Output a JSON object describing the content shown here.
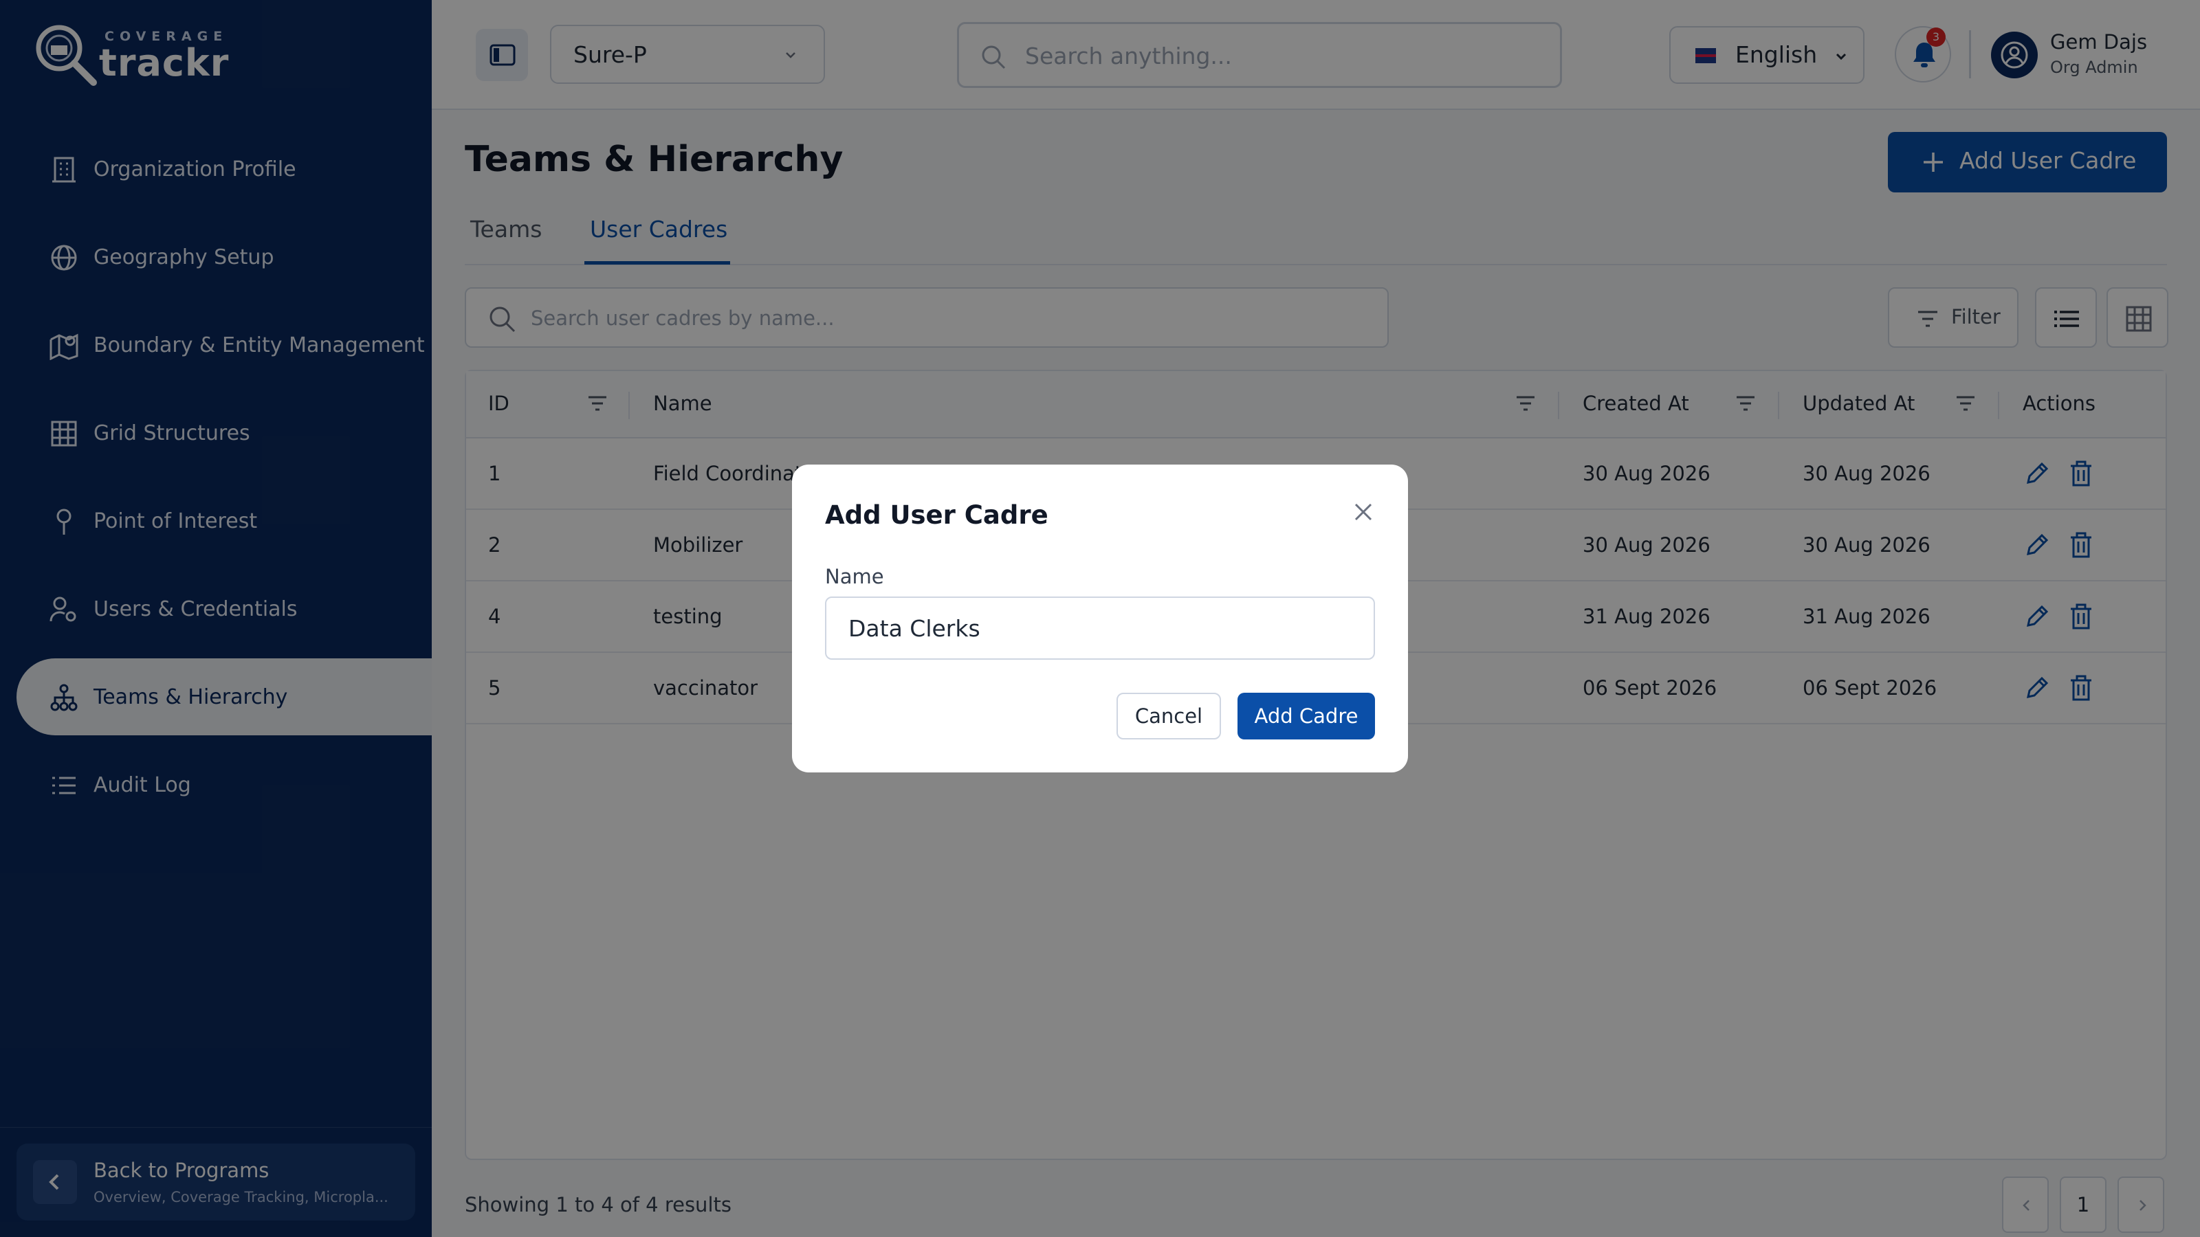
{
  "logo": {
    "sup": "COVERAGE",
    "main": "trackr"
  },
  "sidebar": {
    "items": [
      {
        "label": "Organization Profile",
        "icon": "building-icon"
      },
      {
        "label": "Geography Setup",
        "icon": "globe-icon"
      },
      {
        "label": "Boundary & Entity Management",
        "icon": "map-pin-icon"
      },
      {
        "label": "Grid Structures",
        "icon": "grid-icon"
      },
      {
        "label": "Point of Interest",
        "icon": "pin-icon"
      },
      {
        "label": "Users & Credentials",
        "icon": "user-gear-icon"
      },
      {
        "label": "Teams & Hierarchy",
        "icon": "hierarchy-icon",
        "active": true
      },
      {
        "label": "Audit Log",
        "icon": "list-icon"
      }
    ],
    "back": {
      "title": "Back to Programs",
      "subtitle": "Overview, Coverage Tracking, Micropla..."
    }
  },
  "header": {
    "program": "Sure-P",
    "search_placeholder": "Search anything...",
    "language": "English",
    "notifications": "3",
    "user_name": "Gem Dajs",
    "user_role": "Org Admin"
  },
  "page": {
    "title": "Teams & Hierarchy",
    "add_button": "Add User Cadre",
    "tabs": [
      "Teams",
      "User Cadres"
    ],
    "active_tab": "User Cadres",
    "search_placeholder": "Search user cadres by name...",
    "filter_label": "Filter"
  },
  "table": {
    "columns": [
      "ID",
      "Name",
      "Created At",
      "Updated At",
      "Actions"
    ],
    "rows": [
      {
        "id": "1",
        "name": "Field Coordinat",
        "created": "30 Aug 2026",
        "updated": "30 Aug 2026"
      },
      {
        "id": "2",
        "name": "Mobilizer",
        "created": "30 Aug 2026",
        "updated": "30 Aug 2026"
      },
      {
        "id": "4",
        "name": "testing",
        "created": "31 Aug 2026",
        "updated": "31 Aug 2026"
      },
      {
        "id": "5",
        "name": "vaccinator",
        "created": "06 Sept 2026",
        "updated": "06 Sept 2026"
      }
    ],
    "footer": "Showing 1 to 4 of 4 results",
    "current_page": "1"
  },
  "modal": {
    "title": "Add User Cadre",
    "name_label": "Name",
    "name_value": "Data Clerks",
    "cancel_label": "Cancel",
    "submit_label": "Add Cadre"
  },
  "colors": {
    "sidebar": "#0b2a5e",
    "accent": "#0b4fa8",
    "badge": "#dc2626"
  }
}
